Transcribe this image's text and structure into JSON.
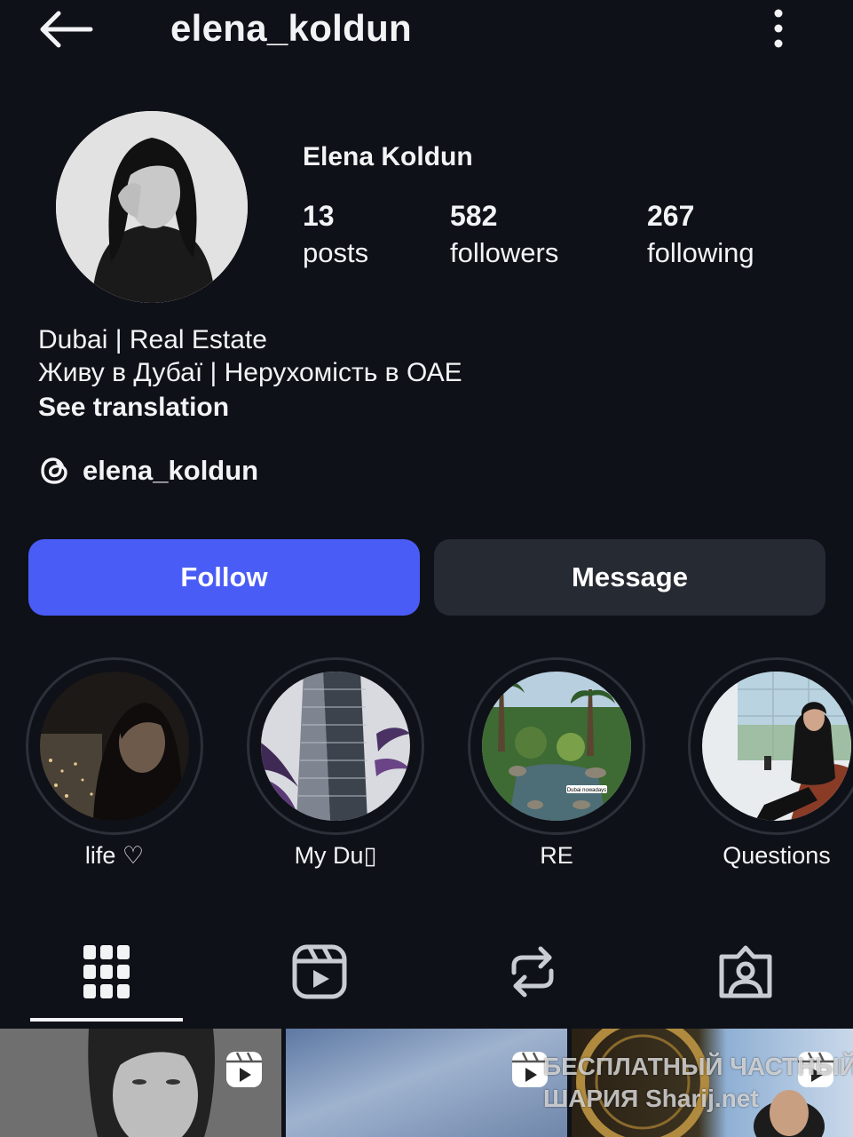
{
  "header": {
    "username": "elena_koldun",
    "back_icon": "arrow-left-icon",
    "more_icon": "vertical-ellipsis-icon"
  },
  "profile": {
    "display_name": "Elena Koldun",
    "stats": [
      {
        "value": "13",
        "label": "posts"
      },
      {
        "value": "582",
        "label": "followers"
      },
      {
        "value": "267",
        "label": "following"
      }
    ],
    "bio_lines": [
      "Dubai | Real Estate",
      "Живу в Дубаї | Нерухомість в ОАЕ"
    ],
    "see_translation": "See translation",
    "threads_handle": "elena_koldun"
  },
  "actions": {
    "follow_label": "Follow",
    "message_label": "Message"
  },
  "highlights": [
    {
      "label": "life ♡"
    },
    {
      "label": "My Du▯"
    },
    {
      "label": "RE"
    },
    {
      "label": "Questions"
    }
  ],
  "highlight_image_text": "Dubai nowadays",
  "tabs": [
    "grid-icon",
    "reels-icon",
    "reposts-icon",
    "tagged-icon"
  ],
  "watermark": {
    "line1": "БЕСПЛАТНЫЙ ЧАСТНЫЙ",
    "line2": "ШАРИЯ Sharij.net"
  },
  "colors": {
    "background": "#0f1118",
    "follow_button": "#4a5cf6",
    "message_button": "#262a33",
    "text": "#f2f3f5"
  }
}
